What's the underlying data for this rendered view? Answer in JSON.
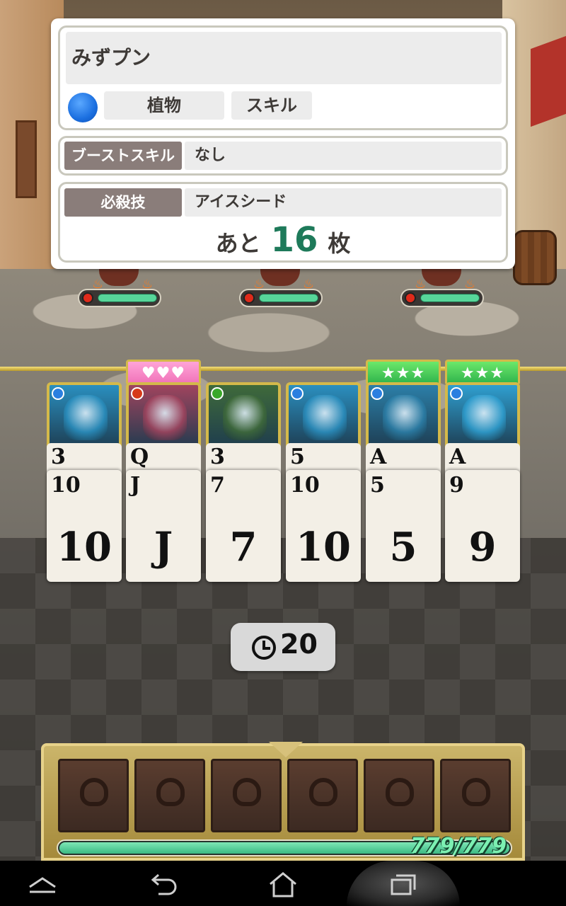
{
  "info_panel": {
    "monster_name": "みずプン",
    "attribute_color": "#1b6fe0",
    "type_label": "植物",
    "skill_button_label": "スキル",
    "boost_skill_label": "ブーストスキル",
    "boost_skill_value": "なし",
    "special_move_label": "必殺技",
    "special_move_value": "アイスシード",
    "remaining_prefix": "あと",
    "remaining_count": "16",
    "remaining_suffix": "枚"
  },
  "enemies": [
    {
      "hp_fraction": 1.0,
      "orb_color": "#e02a1a"
    },
    {
      "hp_fraction": 1.0,
      "orb_color": "#e02a1a"
    },
    {
      "hp_fraction": 1.0,
      "orb_color": "#e02a1a"
    }
  ],
  "cards": [
    {
      "badge": "",
      "badge_type": "none",
      "attribute_color": "#2b7fe0",
      "portrait_color": "#2a8fbf",
      "top_rank": "3",
      "rank": "10",
      "center": "10"
    },
    {
      "badge": "♥♥♥",
      "badge_type": "hearts",
      "attribute_color": "#d63a1a",
      "portrait_color": "#a0445e",
      "top_rank": "Q",
      "rank": "J",
      "center": "J"
    },
    {
      "badge": "",
      "badge_type": "none",
      "attribute_color": "#3aa82a",
      "portrait_color": "#3f6a3a",
      "top_rank": "3",
      "rank": "7",
      "center": "7"
    },
    {
      "badge": "",
      "badge_type": "none",
      "attribute_color": "#2b7fe0",
      "portrait_color": "#2b8fbf",
      "top_rank": "5",
      "rank": "10",
      "center": "10"
    },
    {
      "badge": "★★★",
      "badge_type": "stars",
      "attribute_color": "#2b7fe0",
      "portrait_color": "#2c7fa8",
      "top_rank": "A",
      "rank": "5",
      "center": "5"
    },
    {
      "badge": "★★★",
      "badge_type": "stars",
      "attribute_color": "#2b7fe0",
      "portrait_color": "#2f9fd0",
      "top_rank": "A",
      "rank": "9",
      "center": "9"
    }
  ],
  "timer": {
    "icon": "clock-icon",
    "value": "20"
  },
  "party": {
    "hp_text": "779/779",
    "hp_fraction": 1.0,
    "slot_count": 6
  },
  "navbar": {
    "back_icon": "back-icon",
    "home_icon": "home-icon",
    "recent_icon": "recent-apps-icon",
    "menu_icon": "menu-icon"
  }
}
